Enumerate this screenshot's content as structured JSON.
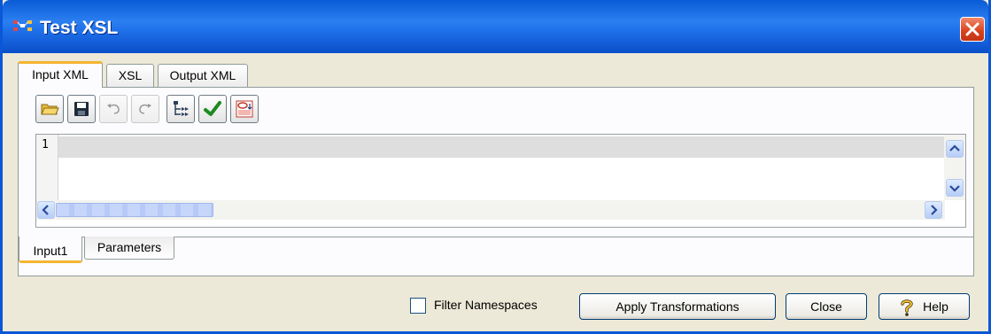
{
  "window": {
    "title": "Test XSL",
    "app_icon": "xsl-app-icon"
  },
  "tabs": [
    "Input XML",
    "XSL",
    "Output XML"
  ],
  "active_tab": "Input XML",
  "toolbar": {
    "buttons": [
      "open-folder-icon",
      "save-disk-icon",
      "undo-icon",
      "redo-icon",
      "tree-structure-icon",
      "validate-check-icon",
      "xml-to-xsl-icon"
    ],
    "disabled": [
      "undo-icon",
      "redo-icon"
    ]
  },
  "editor": {
    "line_numbers": [
      "1"
    ],
    "content": ""
  },
  "bottom_tabs": [
    "Input1",
    "Parameters"
  ],
  "active_bottom_tab": "Input1",
  "footer": {
    "filter_namespaces_label": "Filter Namespaces",
    "filter_namespaces_checked": false,
    "apply_label": "Apply Transformations",
    "close_label": "Close",
    "help_label": "Help"
  },
  "colors": {
    "title_bar": "#0a5bd6",
    "tab_highlight": "#f5b431",
    "close_button": "#d9411c",
    "dialog_bg": "#ece9d8"
  }
}
